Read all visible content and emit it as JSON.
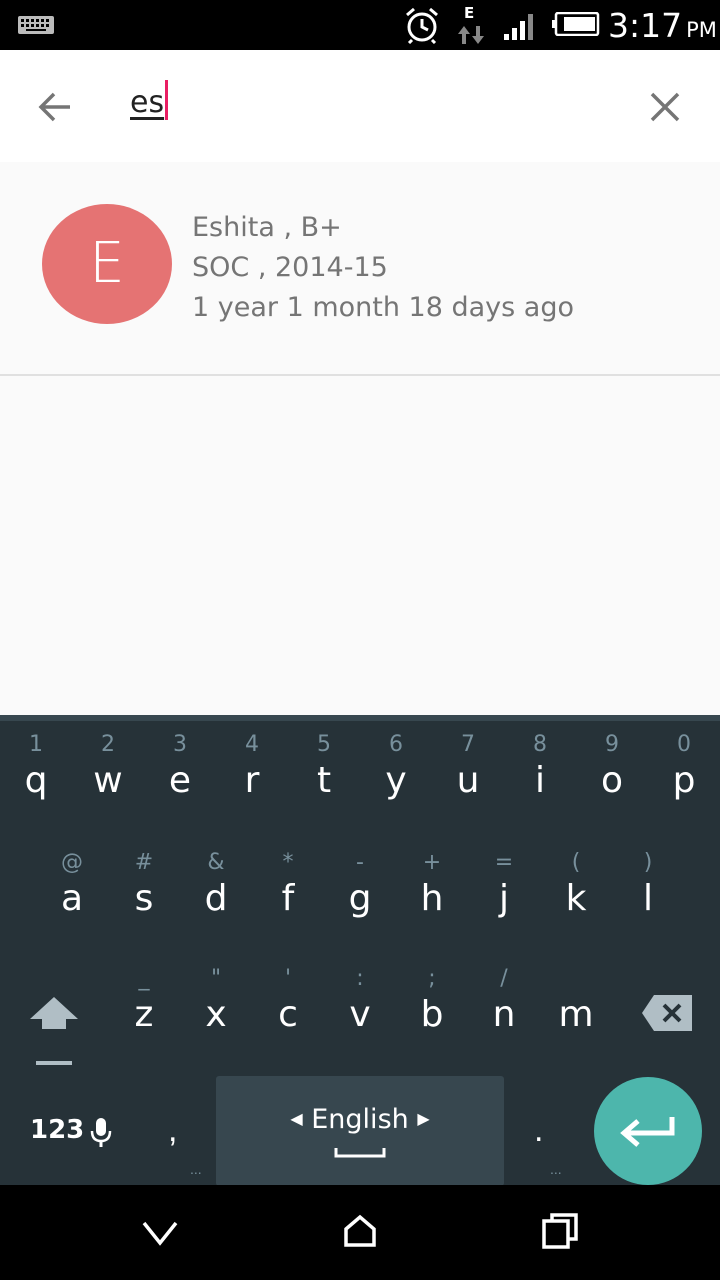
{
  "status_bar": {
    "time": "3:17",
    "ampm": "PM",
    "data_type": "E",
    "icons": [
      "keyboard-icon",
      "alarm-icon",
      "data-arrows-icon",
      "signal-icon",
      "battery-icon"
    ]
  },
  "search": {
    "query": "es",
    "back_icon": "arrow-back-icon",
    "clear_icon": "close-icon"
  },
  "results": [
    {
      "avatar_letter": "E",
      "avatar_color": "#e57373",
      "line1": "Eshita , B+",
      "line2": "SOC , 2014-15",
      "line3": "1 year 1 month 18 days ago"
    }
  ],
  "keyboard": {
    "row1": [
      {
        "hint": "1",
        "key": "q"
      },
      {
        "hint": "2",
        "key": "w"
      },
      {
        "hint": "3",
        "key": "e"
      },
      {
        "hint": "4",
        "key": "r"
      },
      {
        "hint": "5",
        "key": "t"
      },
      {
        "hint": "6",
        "key": "y"
      },
      {
        "hint": "7",
        "key": "u"
      },
      {
        "hint": "8",
        "key": "i"
      },
      {
        "hint": "9",
        "key": "o"
      },
      {
        "hint": "0",
        "key": "p"
      }
    ],
    "row2": [
      {
        "hint": "@",
        "key": "a"
      },
      {
        "hint": "#",
        "key": "s"
      },
      {
        "hint": "&",
        "key": "d"
      },
      {
        "hint": "*",
        "key": "f"
      },
      {
        "hint": "-",
        "key": "g"
      },
      {
        "hint": "+",
        "key": "h"
      },
      {
        "hint": "=",
        "key": "j"
      },
      {
        "hint": "(",
        "key": "k"
      },
      {
        "hint": ")",
        "key": "l"
      }
    ],
    "row3": [
      {
        "hint": "_",
        "key": "z"
      },
      {
        "hint": "\"",
        "key": "x"
      },
      {
        "hint": "'",
        "key": "c"
      },
      {
        "hint": ":",
        "key": "v"
      },
      {
        "hint": ";",
        "key": "b"
      },
      {
        "hint": "/",
        "key": "n"
      },
      {
        "hint": "",
        "key": "m"
      }
    ],
    "symbols_label": "123",
    "comma": ",",
    "period": ".",
    "more_dots": "...",
    "language": "English",
    "enter_color": "#4db6ac"
  },
  "nav_bar": {
    "icons": [
      "nav-back-icon",
      "nav-home-icon",
      "nav-recents-icon"
    ]
  }
}
